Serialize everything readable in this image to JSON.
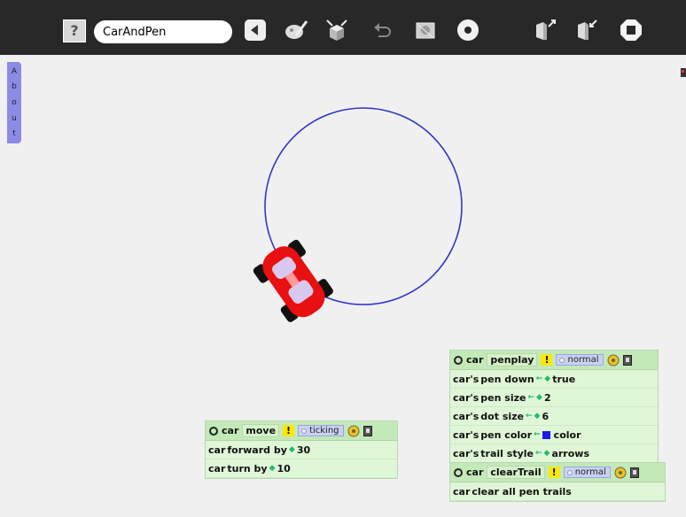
{
  "toolbar": {
    "help_label": "?",
    "project_name": "CarAndPen",
    "icons": [
      "help-icon",
      "back-icon",
      "paint-icon",
      "supplies-icon",
      "undo-icon",
      "view-icon",
      "dot-icon",
      "keep-icon",
      "share-icon",
      "stop-icon"
    ]
  },
  "about_tab": [
    "A",
    "b",
    "o",
    "u",
    "t"
  ],
  "colors": {
    "circle": "#3333cc",
    "car": "#e81010",
    "toolbar": "#282828",
    "script_bg": "#dff6d7",
    "pen_color": "#1b1be6"
  },
  "scripts": {
    "move": {
      "object": "car",
      "name": "move",
      "bang": "!",
      "status": "ticking",
      "tiles": [
        {
          "object": "car",
          "command": "forward by",
          "value": "30"
        },
        {
          "object": "car",
          "command": "turn by",
          "value": "10"
        }
      ]
    },
    "penplay": {
      "object": "car",
      "name": "penplay",
      "bang": "!",
      "status": "normal",
      "tiles": [
        {
          "object": "car's",
          "property": "pen down",
          "value": "true"
        },
        {
          "object": "car's",
          "property": "pen size",
          "value": "2"
        },
        {
          "object": "car's",
          "property": "dot size",
          "value": "6"
        },
        {
          "object": "car's",
          "property": "pen color",
          "value": "color"
        },
        {
          "object": "car's",
          "property": "trail style",
          "value": "arrows"
        }
      ]
    },
    "clearTrail": {
      "object": "car",
      "name": "clearTrail",
      "bang": "!",
      "status": "normal",
      "tiles": [
        {
          "object": "car",
          "command": "clear all pen trails"
        }
      ]
    }
  }
}
